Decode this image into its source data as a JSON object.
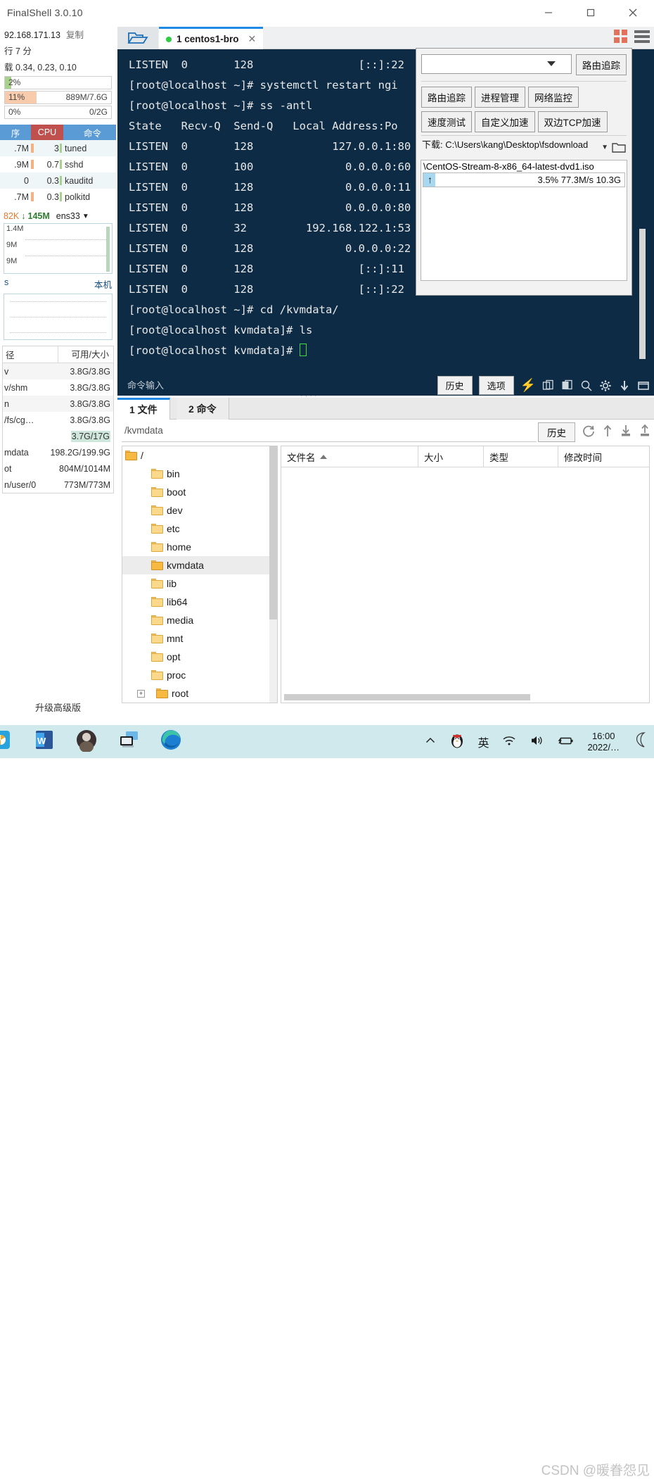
{
  "window": {
    "title": "FinalShell 3.0.10",
    "minimize": "minimize-icon",
    "maximize": "maximize-icon",
    "close": "close-icon"
  },
  "sidebar": {
    "ip": "92.168.171.13",
    "copy_label": "复制",
    "uptime": "7 分",
    "load": "0.34, 0.23, 0.10",
    "meters": [
      {
        "name": "cpu",
        "percent": "2%",
        "right": "",
        "fill_pct": 6,
        "color": "#a9d18e"
      },
      {
        "name": "memory",
        "percent": "11%",
        "right": "889M/7.6G",
        "fill_pct": 11,
        "color": "#f8cbad"
      },
      {
        "name": "swap",
        "percent": "0%",
        "right": "0/2G",
        "fill_pct": 0,
        "color": "#cfe6dc"
      }
    ],
    "process_headers": {
      "mem": "序",
      "cpu": "CPU",
      "cmd": "命令"
    },
    "processes": [
      {
        "mem": ".7M",
        "cpu": "3",
        "cmd": "tuned"
      },
      {
        "mem": ".9M",
        "cpu": "0.7",
        "cmd": "sshd"
      },
      {
        "mem": "0",
        "cpu": "0.3",
        "cmd": "kauditd"
      },
      {
        "mem": ".7M",
        "cpu": "0.3",
        "cmd": "polkitd"
      }
    ],
    "net": {
      "up": "82K",
      "down": "145M",
      "iface": "ens33"
    },
    "net_graph_labels": [
      "1.4M",
      "9M",
      "9M"
    ],
    "local_left": "s",
    "local_right": "本机",
    "disk_headers": {
      "path": "径",
      "size": "可用/大小"
    },
    "disks": [
      {
        "path": "v",
        "size": "3.8G/3.8G",
        "highlight": false
      },
      {
        "path": "v/shm",
        "size": "3.8G/3.8G",
        "highlight": false
      },
      {
        "path": "n",
        "size": "3.8G/3.8G",
        "highlight": false
      },
      {
        "path": "/fs/cg…",
        "size": "3.8G/3.8G",
        "highlight": false
      },
      {
        "path": "",
        "size": "3.7G/17G",
        "highlight": true
      },
      {
        "path": "mdata",
        "size": "198.2G/199.9G",
        "highlight": false
      },
      {
        "path": "ot",
        "size": "804M/1014M",
        "highlight": true
      },
      {
        "path": "n/user/0",
        "size": "773M/773M",
        "highlight": false
      }
    ],
    "upgrade": "升级高级版"
  },
  "tabbar": {
    "folder_icon": "open-folder-icon",
    "tab_label": "1 centos1-bro",
    "close_icon": "close-icon",
    "grid_icon": "grid-view-icon",
    "menu_icon": "hamburger-menu-icon"
  },
  "terminal": {
    "lines": [
      "LISTEN  0       128                [::]:22",
      "[root@localhost ~]# systemctl restart ngi",
      "[root@localhost ~]# ss -antl",
      "State   Recv-Q  Send-Q   Local Address:Po",
      "LISTEN  0       128            127.0.0.1:80",
      "LISTEN  0       100              0.0.0.0:60",
      "LISTEN  0       128              0.0.0.0:11",
      "LISTEN  0       128              0.0.0.0:80",
      "LISTEN  0       32         192.168.122.1:53",
      "LISTEN  0       128              0.0.0.0:22",
      "LISTEN  0       128                [::]:11",
      "LISTEN  0       128                [::]:22",
      "[root@localhost ~]# cd /kvmdata/",
      "[root@localhost kvmdata]# ls"
    ],
    "prompt": "[root@localhost kvmdata]# ",
    "bg": "#0d2b45"
  },
  "cmdbar": {
    "placeholder": "命令输入",
    "history_label": "历史",
    "options_label": "选项",
    "icons": [
      "lightning-icon",
      "copy-icon",
      "paste-icon",
      "search-icon",
      "gear-icon",
      "download-icon",
      "window-icon"
    ]
  },
  "popup": {
    "combo_value": "",
    "trace_button": "路由追踪",
    "buttons": [
      "路由追踪",
      "进程管理",
      "网络监控",
      "速度测试",
      "自定义加速",
      "双边TCP加速"
    ],
    "download_label": "下载: C:\\Users\\kang\\Desktop\\fsdownload",
    "dropdown_icon": "chevron-down-icon",
    "folder_icon": "folder-icon",
    "item_name": "\\CentOS-Stream-8-x86_64-latest-dvd1.iso",
    "item_percent": "3.5%",
    "item_speed": "77.3M/s",
    "item_size": "10.3G",
    "item_status": "3.5% 77.3M/s 10.3G",
    "progress_pct": 3.5
  },
  "lower": {
    "tabs": [
      {
        "label": "1 文件",
        "active": true
      },
      {
        "label": "2 命令",
        "active": false
      }
    ],
    "path": "/kvmdata",
    "history_label": "历史",
    "toolbar_icons": [
      "refresh-icon",
      "up-arrow-icon",
      "download-icon",
      "upload-icon"
    ],
    "tree_root": "/",
    "tree_items": [
      {
        "label": "bin",
        "type": "link",
        "expandable": false,
        "selected": false
      },
      {
        "label": "boot",
        "type": "folder",
        "expandable": false,
        "selected": false
      },
      {
        "label": "dev",
        "type": "folder",
        "expandable": false,
        "selected": false
      },
      {
        "label": "etc",
        "type": "folder",
        "expandable": false,
        "selected": false
      },
      {
        "label": "home",
        "type": "folder",
        "expandable": false,
        "selected": false
      },
      {
        "label": "kvmdata",
        "type": "open",
        "expandable": false,
        "selected": true
      },
      {
        "label": "lib",
        "type": "link",
        "expandable": false,
        "selected": false
      },
      {
        "label": "lib64",
        "type": "link",
        "expandable": false,
        "selected": false
      },
      {
        "label": "media",
        "type": "folder",
        "expandable": false,
        "selected": false
      },
      {
        "label": "mnt",
        "type": "folder",
        "expandable": false,
        "selected": false
      },
      {
        "label": "opt",
        "type": "folder",
        "expandable": false,
        "selected": false
      },
      {
        "label": "proc",
        "type": "folder",
        "expandable": false,
        "selected": false
      },
      {
        "label": "root",
        "type": "open",
        "expandable": true,
        "selected": false
      }
    ],
    "file_columns": [
      "文件名",
      "大小",
      "类型",
      "修改时间"
    ],
    "files": []
  },
  "taskbar": {
    "apps": [
      "chrome-icon",
      "word-icon",
      "profile-avatar-icon",
      "remote-desktop-icon",
      "edge-icon"
    ],
    "tray": [
      "chevron-up-icon",
      "qq-penguin-icon",
      "ime-icon",
      "wifi-icon",
      "volume-icon",
      "battery-icon"
    ],
    "ime_label": "英",
    "time": "16:00",
    "date": "2022/…",
    "moon_icon": "moon-icon",
    "watermark": "CSDN @暖眷怨见"
  }
}
